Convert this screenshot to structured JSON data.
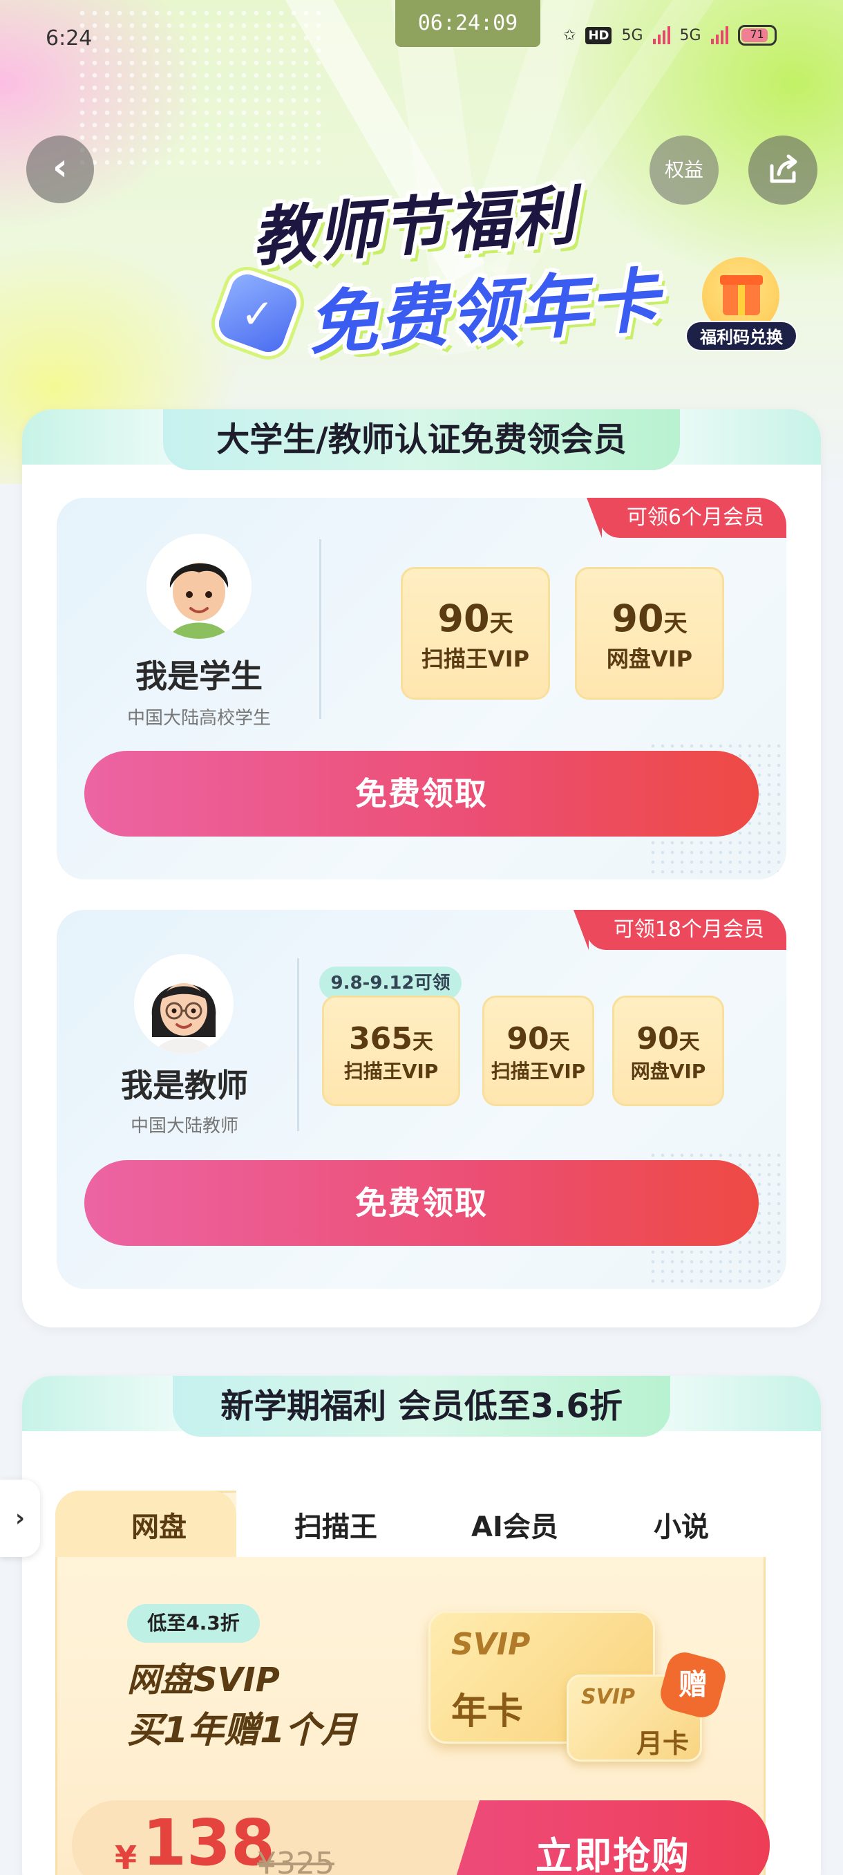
{
  "status_bar": {
    "time": "6:24",
    "recording_time": "06:24:09",
    "hd_label": "HD",
    "network_1": "5G",
    "network_2": "5G",
    "battery": "71"
  },
  "top_bar": {
    "back_icon": "chevron-left-icon",
    "quanyi_label": "权益",
    "share_icon": "share-icon"
  },
  "hero": {
    "title_line1": "教师节福利",
    "title_line2": "免费领年卡",
    "verified_icon": "check-badge-icon",
    "gift_label": "福利码兑换"
  },
  "section1": {
    "title": "大学生/教师认证免费领会员",
    "student": {
      "ribbon": "可领6个月会员",
      "name": "我是学生",
      "subtitle": "中国大陆高校学生",
      "coupons": [
        {
          "num": "90",
          "unit": "天",
          "label": "扫描王VIP"
        },
        {
          "num": "90",
          "unit": "天",
          "label": "网盘VIP"
        }
      ],
      "button": "免费领取"
    },
    "teacher": {
      "ribbon": "可领18个月会员",
      "name": "我是教师",
      "subtitle": "中国大陆教师",
      "date_pill": "9.8-9.12可领",
      "coupons": [
        {
          "num": "365",
          "unit": "天",
          "label": "扫描王VIP"
        },
        {
          "num": "90",
          "unit": "天",
          "label": "扫描王VIP"
        },
        {
          "num": "90",
          "unit": "天",
          "label": "网盘VIP"
        }
      ],
      "button": "免费领取"
    }
  },
  "section2": {
    "title": "新学期福利 会员低至3.6折",
    "side_tab_icon": "chevron-right-icon",
    "tabs": [
      "网盘",
      "扫描王",
      "AI会员",
      "小说"
    ],
    "discount": "低至4.3折",
    "promo_line1": "网盘SVIP",
    "promo_line2": "买1年赠1个月",
    "card_svip": "SVIP",
    "card_year": "年卡",
    "card_month_svip": "SVIP",
    "card_month": "月卡",
    "gift_badge": "赠",
    "currency": "¥",
    "price": "138",
    "old_price": "¥325",
    "buy_button": "立即抢购"
  }
}
